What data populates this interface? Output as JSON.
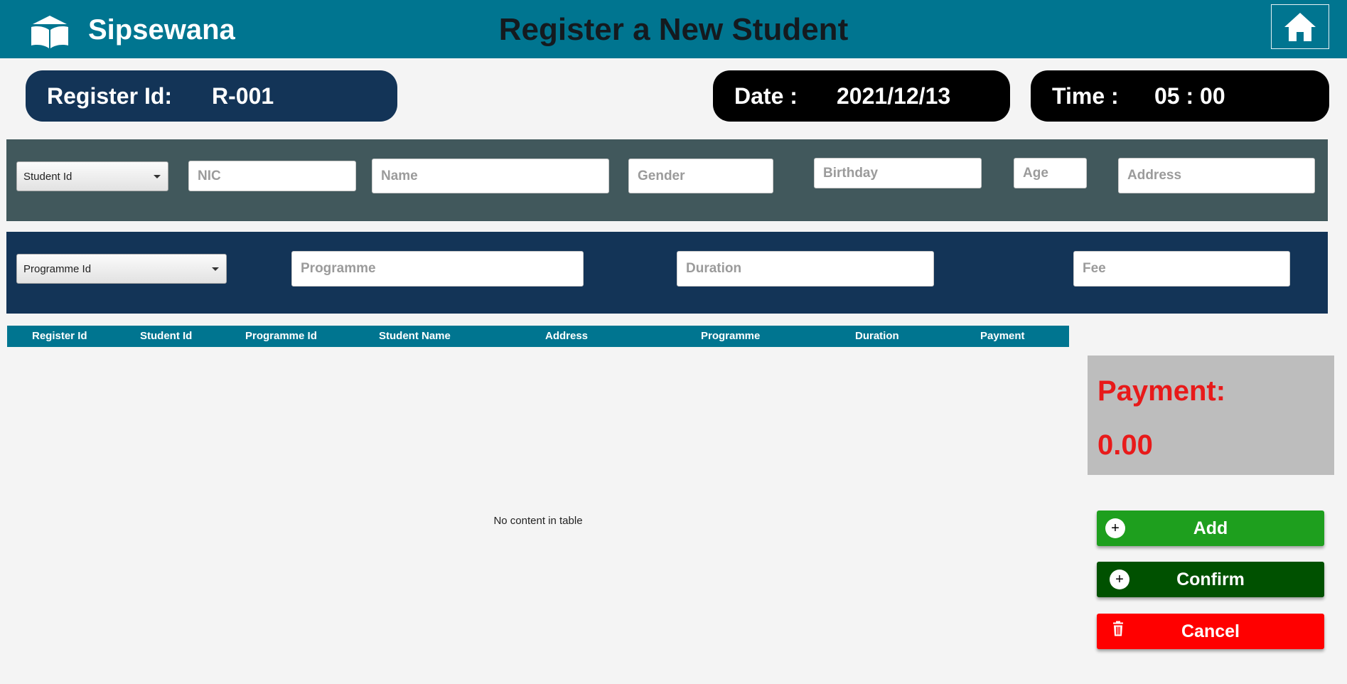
{
  "header": {
    "app_name": "Sipsewana",
    "page_title": "Register a New Student",
    "logo_icon": "open-book-icon",
    "home_icon": "home-icon"
  },
  "info": {
    "register_label": "Register Id:",
    "register_value": "R-001",
    "date_label": "Date :",
    "date_value": "2021/12/13",
    "time_label": "Time :",
    "time_value": "05 : 00"
  },
  "student_form": {
    "student_id_combo": "Student Id",
    "nic_placeholder": "NIC",
    "name_placeholder": "Name",
    "gender_placeholder": "Gender",
    "birthday_placeholder": "Birthday",
    "age_placeholder": "Age",
    "address_placeholder": "Address"
  },
  "programme_form": {
    "programme_id_combo": "Programme Id",
    "programme_placeholder": "Programme",
    "duration_placeholder": "Duration",
    "fee_placeholder": "Fee"
  },
  "table": {
    "columns": [
      "Register Id",
      "Student Id",
      "Programme Id",
      "Student Name",
      "Address",
      "Programme",
      "Duration",
      "Payment"
    ],
    "empty_text": "No content in table"
  },
  "payment": {
    "label": "Payment:",
    "value": "0.00"
  },
  "actions": {
    "add_label": "Add",
    "confirm_label": "Confirm",
    "cancel_label": "Cancel"
  },
  "colors": {
    "header_bg": "#007590",
    "navy": "#133457",
    "slate": "#41585c",
    "add": "#1e9f1e",
    "confirm": "#005100",
    "cancel": "#ff0000",
    "payment_text": "#e81a1a"
  }
}
